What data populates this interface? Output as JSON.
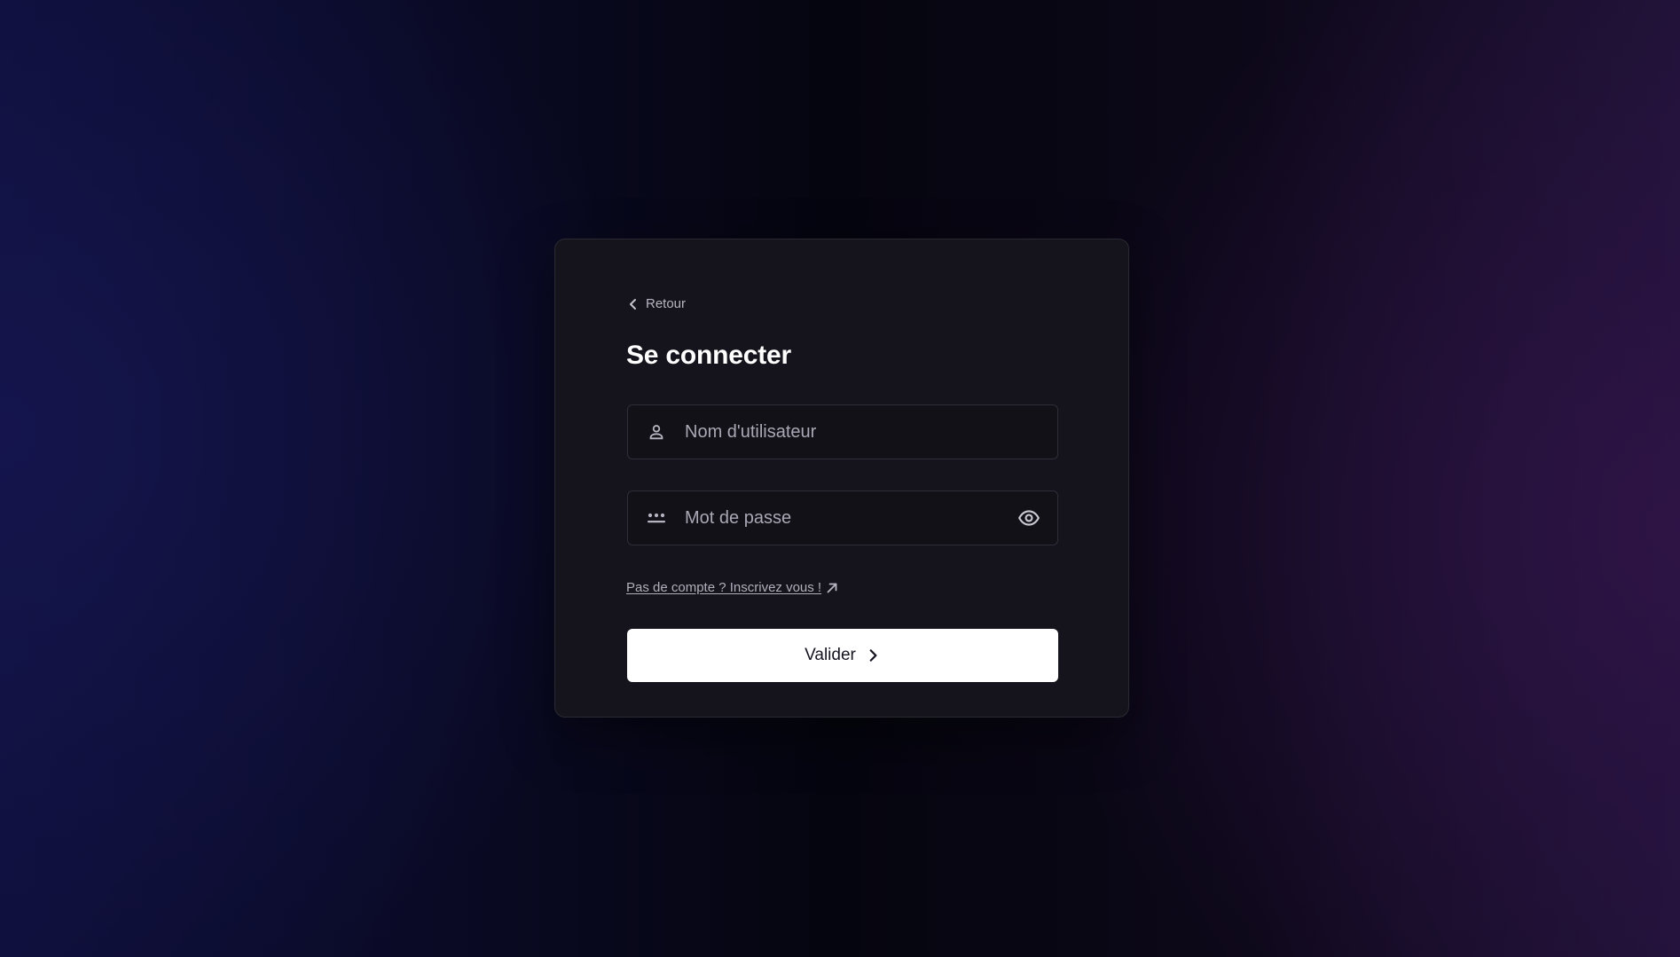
{
  "login": {
    "back_label": "Retour",
    "title": "Se connecter",
    "username": {
      "placeholder": "Nom d'utilisateur",
      "value": "",
      "icon": "user-icon"
    },
    "password": {
      "placeholder": "Mot de passe",
      "value": "",
      "icon": "password-dots-icon",
      "toggle_icon": "eye-icon"
    },
    "signup_link": "Pas de compte ? Inscrivez vous !",
    "signup_icon": "external-arrow-icon",
    "submit_label": "Valider",
    "submit_icon": "chevron-right-icon"
  },
  "colors": {
    "card_bg": "#15141c",
    "button_bg": "#ffffff",
    "text_muted": "#b7b6c2"
  }
}
